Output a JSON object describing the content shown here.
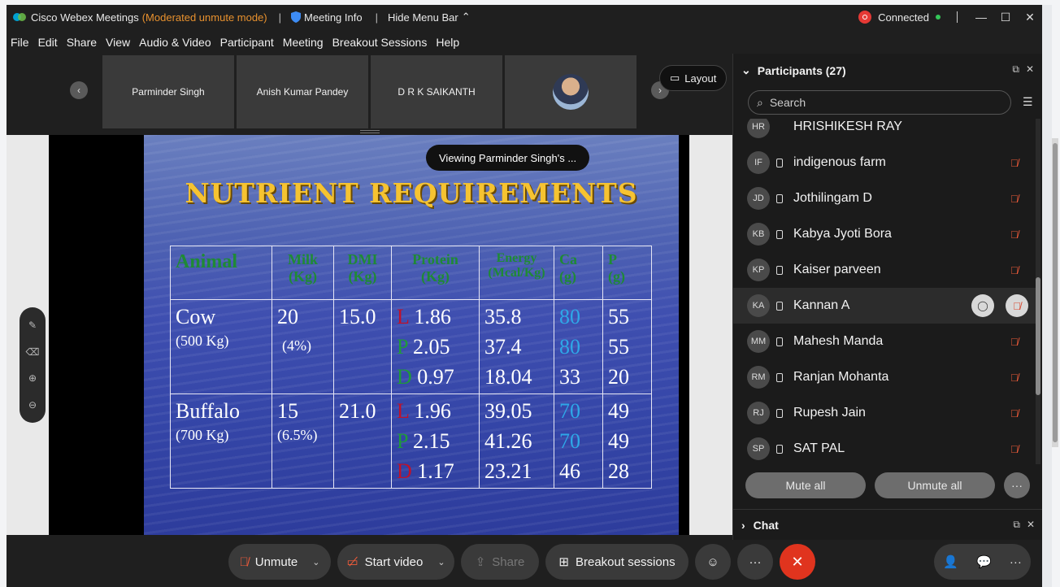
{
  "window": {
    "app_title": "Cisco Webex Meetings",
    "mode": "(Moderated unmute mode)",
    "separator": "|",
    "meeting_info": "Meeting Info",
    "hide_menu": "Hide Menu Bar",
    "status": "Connected"
  },
  "menu": [
    "File",
    "Edit",
    "Share",
    "View",
    "Audio & Video",
    "Participant",
    "Meeting",
    "Breakout Sessions",
    "Help"
  ],
  "tiles": [
    "Parminder Singh",
    "Anish Kumar Pandey",
    "D R K SAIKANTH"
  ],
  "layout_label": "Layout",
  "viewing_label": "Viewing Parminder Singh's ...",
  "slide": {
    "title": "NUTRIENT REQUIREMENTS",
    "headers": {
      "animal": "Animal",
      "milk1": "Milk",
      "milk2": "(Kg)",
      "dmi1": "DMI",
      "dmi2": "(Kg)",
      "protein1": "Protein",
      "protein2": "(Kg)",
      "energy1": "Energy",
      "energy2": "(Mcal/Kg)",
      "ca1": "Ca",
      "ca2": "(g)",
      "p1": "P",
      "p2": "(g)"
    },
    "rows": [
      {
        "animal": "Cow",
        "weight": "(500 Kg)",
        "milk": "20",
        "milk_fat": "(4%)",
        "dmi": "15.0",
        "protein": [
          {
            "tag": "L",
            "val": "1.86"
          },
          {
            "tag": "P",
            "val": "2.05"
          },
          {
            "tag": "D",
            "val": "0.97"
          }
        ],
        "energy": [
          "35.8",
          "37.4",
          "18.04"
        ],
        "ca": [
          "80",
          "80",
          "33"
        ],
        "p": [
          "55",
          "55",
          "20"
        ]
      },
      {
        "animal": "Buffalo",
        "weight": "(700 Kg)",
        "milk": "15",
        "milk_fat": "(6.5%)",
        "dmi": "21.0",
        "protein": [
          {
            "tag": "L",
            "val": "1.96"
          },
          {
            "tag": "P",
            "val": "2.15"
          },
          {
            "tag": "D",
            "val": "1.17"
          }
        ],
        "energy": [
          "39.05",
          "41.26",
          "23.21"
        ],
        "ca": [
          "70",
          "70",
          "46"
        ],
        "p": [
          "49",
          "49",
          "28"
        ]
      }
    ]
  },
  "participants": {
    "title": "Participants (27)",
    "search_placeholder": "Search",
    "list": [
      {
        "initials": "HR",
        "name": "HRISHIKESH RAY"
      },
      {
        "initials": "IF",
        "name": "indigenous farm"
      },
      {
        "initials": "JD",
        "name": "Jothilingam D"
      },
      {
        "initials": "KB",
        "name": "Kabya Jyoti Bora"
      },
      {
        "initials": "KP",
        "name": "Kaiser parveen"
      },
      {
        "initials": "KA",
        "name": "Kannan A"
      },
      {
        "initials": "MM",
        "name": "Mahesh Manda"
      },
      {
        "initials": "RM",
        "name": "Ranjan Mohanta"
      },
      {
        "initials": "RJ",
        "name": "Rupesh Jain"
      },
      {
        "initials": "SP",
        "name": "SAT PAL"
      }
    ],
    "mute_all": "Mute all",
    "unmute_all": "Unmute all"
  },
  "chat_label": "Chat",
  "controls": {
    "unmute": "Unmute",
    "start_video": "Start video",
    "share": "Share",
    "breakout": "Breakout sessions"
  },
  "colors": {
    "title_gold": "#f6c331",
    "header_green": "#1f8a35",
    "ca_blue": "#2ea8e8",
    "mute_red": "#f25c3a",
    "end_red": "#e0341e",
    "mode_orange": "#e8912e"
  }
}
